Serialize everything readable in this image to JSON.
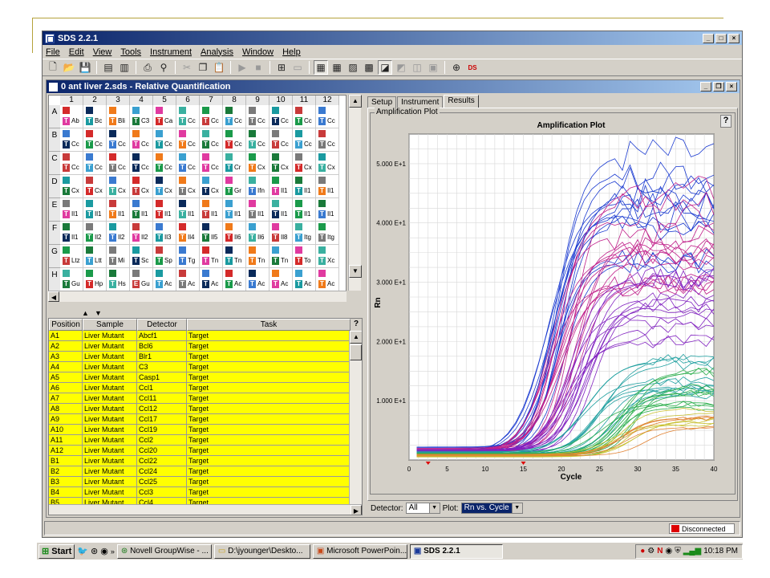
{
  "app": {
    "title": "SDS 2.2.1"
  },
  "menu": [
    "File",
    "Edit",
    "View",
    "Tools",
    "Instrument",
    "Analysis",
    "Window",
    "Help"
  ],
  "doc": {
    "title": "0 ant liver 2.sds - Relative Quantification"
  },
  "plate": {
    "columns": [
      "1",
      "2",
      "3",
      "4",
      "5",
      "6",
      "7",
      "8",
      "9",
      "10",
      "11",
      "12"
    ],
    "rows": [
      "A",
      "B",
      "C",
      "D",
      "E",
      "F",
      "G",
      "H"
    ],
    "labels": [
      [
        "Ab",
        "Bc",
        "Bli",
        "C3",
        "Ca",
        "Cc",
        "Cc",
        "Cc",
        "Cc",
        "Cc",
        "Cc",
        "Cc"
      ],
      [
        "Cc",
        "Cc",
        "Cc",
        "Cc",
        "Cc",
        "Cc",
        "Cc",
        "Cc",
        "Cc",
        "Cc",
        "Cc",
        "Cc"
      ],
      [
        "Cc",
        "Cc",
        "Cc",
        "Cc",
        "Cc",
        "Cc",
        "Cc",
        "Cr",
        "Cx",
        "Cx",
        "Cx",
        "Cx"
      ],
      [
        "Cx",
        "Cx",
        "Cx",
        "Cx",
        "Cx",
        "Cx",
        "Cx",
        "Gr",
        "Ifn",
        "Il1",
        "Il1",
        "Il1"
      ],
      [
        "Il1",
        "Il1",
        "Il1",
        "Il1",
        "Il1",
        "Il1",
        "Il1",
        "Il1",
        "Il1",
        "Il1",
        "Il1",
        "Il1"
      ],
      [
        "Il1",
        "Il2",
        "Il2",
        "Il2",
        "Il3",
        "Il4",
        "Il5",
        "Il6",
        "Il6",
        "Il8",
        "Itg",
        "Itg"
      ],
      [
        "Ltz",
        "Ltt",
        "Mi",
        "Sc",
        "Sp",
        "Tg",
        "Tn",
        "Tn",
        "Tn",
        "Tn",
        "To",
        "Xc"
      ],
      [
        "Gu",
        "Hp",
        "Hs",
        "Gu",
        "Ac",
        "Ac",
        "Ac",
        "Ac",
        "Ac",
        "Ac",
        "Ac",
        "Ac"
      ]
    ],
    "tag_letters": [
      [
        "T",
        "T",
        "T",
        "T",
        "T",
        "T",
        "T",
        "T",
        "T",
        "T",
        "T",
        "T"
      ],
      [
        "T",
        "T",
        "T",
        "T",
        "T",
        "T",
        "T",
        "T",
        "T",
        "T",
        "T",
        "T"
      ],
      [
        "T",
        "T",
        "T",
        "T",
        "T",
        "T",
        "T",
        "T",
        "T",
        "T",
        "T",
        "T"
      ],
      [
        "T",
        "T",
        "T",
        "T",
        "T",
        "T",
        "T",
        "T",
        "T",
        "T",
        "T",
        "T"
      ],
      [
        "T",
        "T",
        "T",
        "T",
        "T",
        "T",
        "T",
        "T",
        "T",
        "T",
        "T",
        "T"
      ],
      [
        "T",
        "T",
        "T",
        "T",
        "T",
        "T",
        "T",
        "T",
        "T",
        "T",
        "T",
        "T"
      ],
      [
        "T",
        "T",
        "T",
        "T",
        "T",
        "T",
        "T",
        "T",
        "T",
        "T",
        "T",
        "T"
      ],
      [
        "T",
        "T",
        "T",
        "E",
        "T",
        "T",
        "T",
        "T",
        "T",
        "T",
        "T",
        "T"
      ]
    ],
    "palette": [
      "#d42a2a",
      "#1a7a3a",
      "#f07a1a",
      "#1a9aa0",
      "#e03aa0",
      "#3a7ad0",
      "#1a9a4a",
      "#0a2a5a",
      "#7a7a7a",
      "#3aa0d0",
      "#c83a3a",
      "#3ab0a0"
    ]
  },
  "table": {
    "headers": [
      "Position",
      "Sample",
      "Detector",
      "Task"
    ],
    "rows": [
      [
        "A1",
        "Liver Mutant",
        "Abcf1",
        "Target"
      ],
      [
        "A2",
        "Liver Mutant",
        "Bcl6",
        "Target"
      ],
      [
        "A3",
        "Liver Mutant",
        "Blr1",
        "Target"
      ],
      [
        "A4",
        "Liver Mutant",
        "C3",
        "Target"
      ],
      [
        "A5",
        "Liver Mutant",
        "Casp1",
        "Target"
      ],
      [
        "A6",
        "Liver Mutant",
        "Ccl1",
        "Target"
      ],
      [
        "A7",
        "Liver Mutant",
        "Ccl11",
        "Target"
      ],
      [
        "A8",
        "Liver Mutant",
        "Ccl12",
        "Target"
      ],
      [
        "A9",
        "Liver Mutant",
        "Ccl17",
        "Target"
      ],
      [
        "A10",
        "Liver Mutant",
        "Ccl19",
        "Target"
      ],
      [
        "A11",
        "Liver Mutant",
        "Ccl2",
        "Target"
      ],
      [
        "A12",
        "Liver Mutant",
        "Ccl20",
        "Target"
      ],
      [
        "B1",
        "Liver Mutant",
        "Ccl22",
        "Target"
      ],
      [
        "B2",
        "Liver Mutant",
        "Ccl24",
        "Target"
      ],
      [
        "B3",
        "Liver Mutant",
        "Ccl25",
        "Target"
      ],
      [
        "B4",
        "Liver Mutant",
        "Ccl3",
        "Target"
      ],
      [
        "B5",
        "Liver Mutant",
        "Ccl4",
        "Target"
      ]
    ]
  },
  "tabs": [
    "Setup",
    "Instrument",
    "Results"
  ],
  "group_label": "Amplification Plot",
  "chart_data": {
    "type": "line",
    "title": "Amplification Plot",
    "xlabel": "Cycle",
    "ylabel": "Rn",
    "xlim": [
      0,
      40
    ],
    "ylim": [
      0,
      5.5
    ],
    "xticks": [
      0,
      5,
      10,
      15,
      20,
      25,
      30,
      35,
      40
    ],
    "yticks": [
      {
        "v": 1,
        "label": "1.000 E+1"
      },
      {
        "v": 2,
        "label": "2.000 E+1"
      },
      {
        "v": 3,
        "label": "3.000 E+1"
      },
      {
        "v": 4,
        "label": "4.000 E+1"
      },
      {
        "v": 5,
        "label": "5.000 E+1"
      }
    ],
    "grid": true,
    "series_groups": [
      {
        "color": "#1a3ad0",
        "count": 14,
        "ct": [
          22,
          24,
          36
        ],
        "plateau": [
          3.2,
          5.2
        ],
        "baseline": [
          0.08,
          0.22
        ]
      },
      {
        "color": "#c0208a",
        "count": 16,
        "ct": [
          22,
          26,
          28
        ],
        "plateau": [
          2.8,
          4.5
        ],
        "baseline": [
          0.1,
          0.2
        ]
      },
      {
        "color": "#8020c0",
        "count": 14,
        "ct": [
          24,
          28,
          30
        ],
        "plateau": [
          1.8,
          3.0
        ],
        "baseline": [
          0.1,
          0.18
        ]
      },
      {
        "color": "#20a0a0",
        "count": 12,
        "ct": [
          27,
          32,
          34
        ],
        "plateau": [
          0.9,
          1.8
        ],
        "baseline": [
          0.08,
          0.15
        ]
      },
      {
        "color": "#30b050",
        "count": 12,
        "ct": [
          28,
          33,
          35
        ],
        "plateau": [
          0.8,
          1.6
        ],
        "baseline": [
          0.06,
          0.12
        ]
      },
      {
        "color": "#c8c030",
        "count": 6,
        "ct": [
          30,
          34,
          36
        ],
        "plateau": [
          0.5,
          0.9
        ],
        "baseline": [
          0.05,
          0.1
        ]
      },
      {
        "color": "#e08030",
        "count": 5,
        "ct": [
          31,
          35,
          37
        ],
        "plateau": [
          0.4,
          0.7
        ],
        "baseline": [
          0.05,
          0.1
        ]
      }
    ]
  },
  "controls": {
    "detector_label": "Detector:",
    "detector_value": "All",
    "plot_label": "Plot:",
    "plot_value": "Rn vs. Cycle"
  },
  "status": {
    "connection": "Disconnected"
  },
  "taskbar": {
    "start": "Start",
    "items": [
      "Novell GroupWise - ...",
      "D:\\jyounger\\Deskto...",
      "Microsoft PowerPoin...",
      "SDS 2.2.1"
    ],
    "clock": "10:18 PM"
  }
}
